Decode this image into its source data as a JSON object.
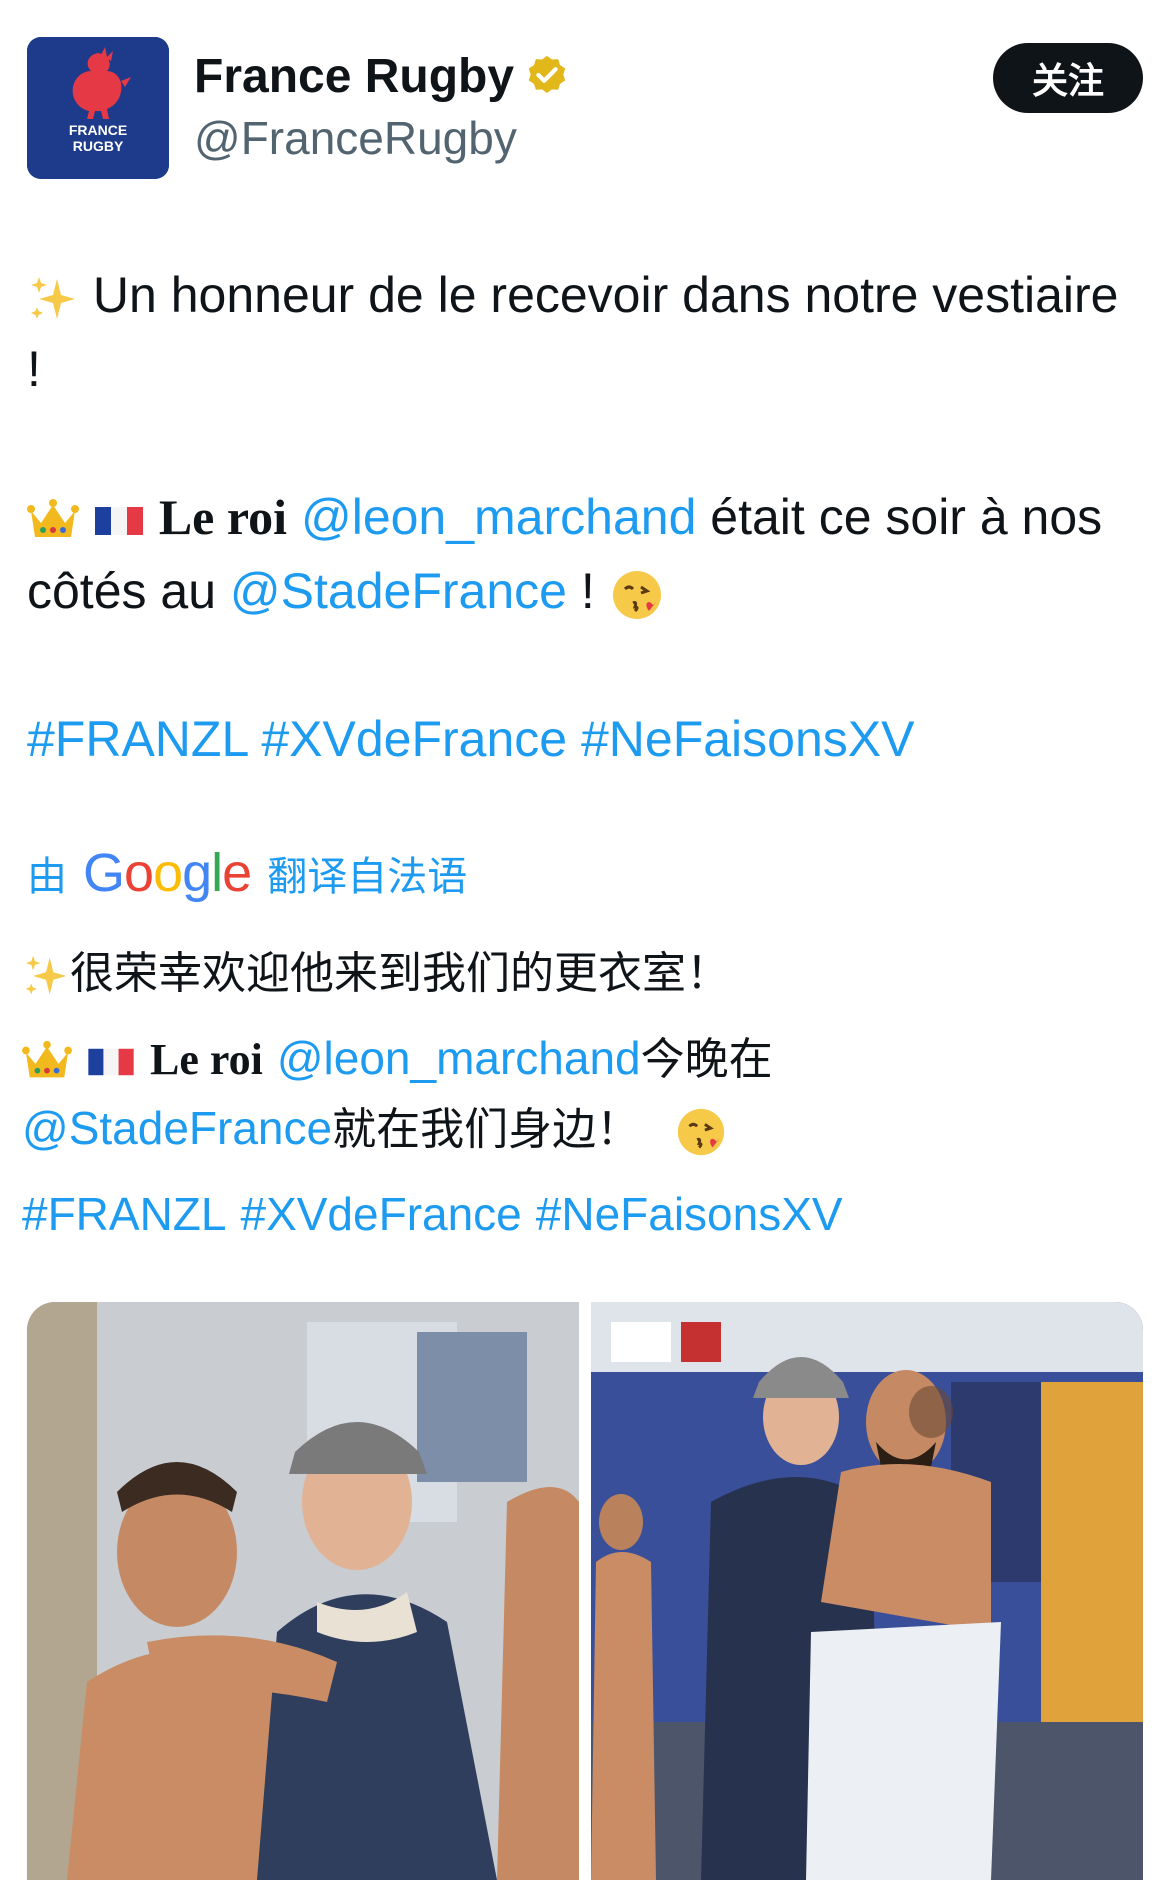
{
  "account": {
    "display_name": "France Rugby",
    "handle": "@FranceRugby",
    "avatar_text_line1": "FRANCE",
    "avatar_text_line2": "RUGBY",
    "verified_icon": "gold-verified-badge",
    "follow_label": "关注"
  },
  "tweet": {
    "line1_emoji": "sparkles",
    "line1_text": "Un honneur de le recevoir dans notre vestiaire !",
    "line2_emoji": [
      "crown",
      "flag-france"
    ],
    "line2_prefix": "Le roi",
    "mention1": "@leon_marchand",
    "line2_middle": "était ce soir à nos côtés au",
    "mention2": "@StadeFrance",
    "line2_suffix": "!",
    "line2_end_emoji": "face-blowing-kiss",
    "hashtags": [
      "#FRANZL",
      "#XVdeFrance",
      "#NeFaisonsXV"
    ]
  },
  "translation_bar": {
    "prefix": "由",
    "brand": "Google",
    "suffix": "翻译自法语"
  },
  "translation": {
    "line1": "很荣幸欢迎他来到我们的更衣室！",
    "line2_prefix": "Le roi",
    "mention1": "@leon_marchand",
    "line2_middle": "今晚在",
    "mention2": "@StadeFrance",
    "line2_suffix": "就在我们身边！",
    "hashtags": [
      "#FRANZL",
      "#XVdeFrance",
      "#NeFaisonsXV"
    ]
  },
  "media": {
    "count": 2
  },
  "colors": {
    "link": "#1d9bf0",
    "text": "#0f1419",
    "secondary": "#536471",
    "avatar_bg": "#1e3a8a",
    "rooster": "#e63946",
    "verified": "#e2b719"
  }
}
